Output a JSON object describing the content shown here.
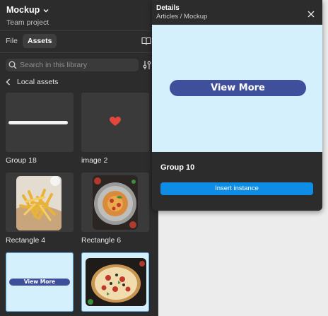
{
  "project": {
    "name": "Mockup",
    "subtitle": "Team project"
  },
  "tabs": [
    {
      "label": "File"
    },
    {
      "label": "Assets"
    }
  ],
  "search": {
    "placeholder": "Search in this library"
  },
  "section": {
    "label": "Local assets"
  },
  "assets": [
    {
      "name": "Group 18"
    },
    {
      "name": "image 2"
    },
    {
      "name": "Rectangle 4"
    },
    {
      "name": "Rectangle 6"
    },
    {
      "name": "",
      "button_text": "View More"
    },
    {
      "name": ""
    }
  ],
  "details": {
    "title": "Details",
    "path": "Articles / Mockup",
    "preview_button_text": "View More",
    "component_name": "Group 10",
    "insert_label": "Insert instance"
  },
  "colors": {
    "accent_blue": "#0d8de6",
    "pill_indigo": "#3f4f9b",
    "preview_bg": "#d4f0fd",
    "heart_red": "#e2463c"
  }
}
